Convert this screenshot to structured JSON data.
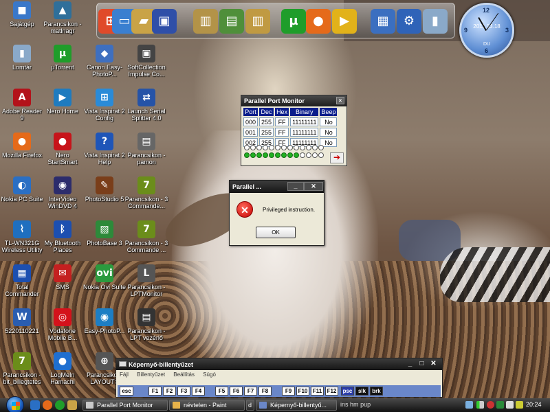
{
  "desktop": {
    "icons": [
      {
        "label": "Sajátgép",
        "color": "#3a78c9",
        "glyph": "■"
      },
      {
        "label": "Parancsikon - matlnagr",
        "color": "#2f6f9a",
        "glyph": "▲"
      },
      {
        "label": "Lomtár",
        "color": "#8aa9c9",
        "glyph": "▮"
      },
      {
        "label": "µTorrent",
        "color": "#1f9d2a",
        "glyph": "µ"
      },
      {
        "label": "Canon Easy-PhotoP...",
        "color": "#3e6fbf",
        "glyph": "◆"
      },
      {
        "label": "SoftCollection Impulse Co...",
        "color": "#444",
        "glyph": "▣"
      },
      {
        "label": "Adobe Reader 9",
        "color": "#b3121a",
        "glyph": "A"
      },
      {
        "label": "Nero Home",
        "color": "#1e7bbf",
        "glyph": "▶"
      },
      {
        "label": "Vista Inspirat 2 Config",
        "color": "#2a8bd8",
        "glyph": "⊞"
      },
      {
        "label": "Launch Serial Splitter 4.0",
        "color": "#2553a7",
        "glyph": "⇄"
      },
      {
        "label": "Mozilla Firefox",
        "color": "#e56a1a",
        "glyph": "●"
      },
      {
        "label": "Nero StartSmart",
        "color": "#c7141a",
        "glyph": "●"
      },
      {
        "label": "Vista Inspirat 2 Help",
        "color": "#1e55b8",
        "glyph": "?"
      },
      {
        "label": "Parancsikon - pamon",
        "color": "#666",
        "glyph": "▤"
      },
      {
        "label": "Nokia PC Suite",
        "color": "#2a6fc4",
        "glyph": "◐"
      },
      {
        "label": "InterVideo WinDVD 4",
        "color": "#2c2c6c",
        "glyph": "◉"
      },
      {
        "label": "PhotoStudio 5",
        "color": "#7a3e1a",
        "glyph": "✎"
      },
      {
        "label": "Parancsikon - 3 Commande...",
        "color": "#6b8d1a",
        "glyph": "7"
      },
      {
        "label": "TL-WN321G Wireless Utility",
        "color": "#1f6fbf",
        "glyph": "⌇"
      },
      {
        "label": "My Bluetooth Places",
        "color": "#1c4fb0",
        "glyph": "ᛒ"
      },
      {
        "label": "PhotoBase 3",
        "color": "#2d8a3a",
        "glyph": "▧"
      },
      {
        "label": "Parancsikon - 3 Commande ...",
        "color": "#6b8d1a",
        "glyph": "7"
      },
      {
        "label": "Total Commander",
        "color": "#1c4fb0",
        "glyph": "▦"
      },
      {
        "label": "SMS",
        "color": "#c42020",
        "glyph": "✉"
      },
      {
        "label": "Nokia Ovi Suite",
        "color": "#2b9a3e",
        "glyph": "ovi"
      },
      {
        "label": "Parancsikon - LPTMonitor",
        "color": "#555",
        "glyph": "L"
      },
      {
        "label": "5220110221",
        "color": "#2a5db0",
        "glyph": "W"
      },
      {
        "label": "Vodafone Mobile B...",
        "color": "#d4121b",
        "glyph": "◎"
      },
      {
        "label": "Easy-PhotoP...",
        "color": "#1d7ec4",
        "glyph": "◉"
      },
      {
        "label": "Parancsikon - LPT vezérlő",
        "color": "#333",
        "glyph": "▤"
      },
      {
        "label": "Parancsikon - bit_billegtetes",
        "color": "#6b8d1a",
        "glyph": "7"
      },
      {
        "label": "LogMeIn Hamachi",
        "color": "#1f6fd0",
        "glyph": "●"
      },
      {
        "label": "Parancsiko... LAYOUTS",
        "color": "#555",
        "glyph": "⊕"
      }
    ]
  },
  "dock": {
    "items": [
      {
        "name": "windows-logo-icon",
        "color": "#e04a2a",
        "glyph": "⊞"
      },
      {
        "name": "network-computer-icon",
        "color": "#3a7fd0",
        "glyph": "▭"
      },
      {
        "name": "folder-icon",
        "color": "#c9a347",
        "glyph": "▰"
      },
      {
        "name": "save-icon",
        "color": "#2f4fa8",
        "glyph": "▣"
      },
      {
        "name": "library-icon",
        "color": "#b39348",
        "glyph": "▥"
      },
      {
        "name": "documents-icon",
        "color": "#4f8f3a",
        "glyph": "▤"
      },
      {
        "name": "folders-icon",
        "color": "#c09a42",
        "glyph": "▥"
      },
      {
        "name": "utorrent-icon",
        "color": "#1f9d2a",
        "glyph": "µ"
      },
      {
        "name": "firefox-icon",
        "color": "#e56a1a",
        "glyph": "●"
      },
      {
        "name": "media-player-icon",
        "color": "#e2b21a",
        "glyph": "▶"
      },
      {
        "name": "window-manager-icon",
        "color": "#3b6fc0",
        "glyph": "▦"
      },
      {
        "name": "settings-gear-icon",
        "color": "#2f63b8",
        "glyph": "⚙"
      },
      {
        "name": "recycle-bin-icon",
        "color": "#8aa9c9",
        "glyph": "▮"
      }
    ]
  },
  "clock_gadget": {
    "date": "2011.03.18",
    "ampm": "DU",
    "numerals": [
      "12",
      "3",
      "6",
      "9"
    ]
  },
  "port_monitor": {
    "title": "Parallel Port Monitor",
    "close_label": "×",
    "columns": [
      "Port",
      "Dec",
      "Hex",
      "Binary",
      "Beep"
    ],
    "rows": [
      [
        "000",
        "255",
        "FF",
        "11111111",
        "No"
      ],
      [
        "001",
        "255",
        "FF",
        "11111111",
        "No"
      ],
      [
        "002",
        "255",
        "FF",
        "11111111",
        "No"
      ]
    ],
    "led_row1": [
      false,
      false,
      false,
      false,
      false,
      false,
      false,
      false,
      false,
      false,
      false,
      false,
      false
    ],
    "led_row2": [
      true,
      true,
      true,
      true,
      true,
      true,
      true,
      true,
      true,
      false,
      false,
      false,
      false
    ],
    "arrow_label": "➔"
  },
  "error_dialog": {
    "title": "Parallel ...",
    "minimize_label": "_",
    "close_label": "✕",
    "icon_glyph": "✕",
    "message": "Privileged instruction.",
    "ok_label": "OK"
  },
  "osk": {
    "title": "Képernyő-billentyűzet",
    "minimize_label": "_",
    "maximize_label": "□",
    "close_label": "✕",
    "menu": [
      "Fájl",
      "Billentyűzet",
      "Beállítás",
      "Súgó"
    ],
    "keys": [
      "esc",
      "F1",
      "F2",
      "F3",
      "F4",
      "F5",
      "F6",
      "F7",
      "F8",
      "F9",
      "F10",
      "F11",
      "F12",
      "psc",
      "slk",
      "brk"
    ]
  },
  "taskbar": {
    "tasks": [
      {
        "label": "Parallel Port Monitor"
      },
      {
        "label": "névtelen - Paint"
      },
      {
        "label": "Képernyő-billentyű..."
      }
    ],
    "hidden_partial": [
      "d",
      "ins",
      "hm",
      "pup"
    ],
    "clock": "20:24"
  }
}
